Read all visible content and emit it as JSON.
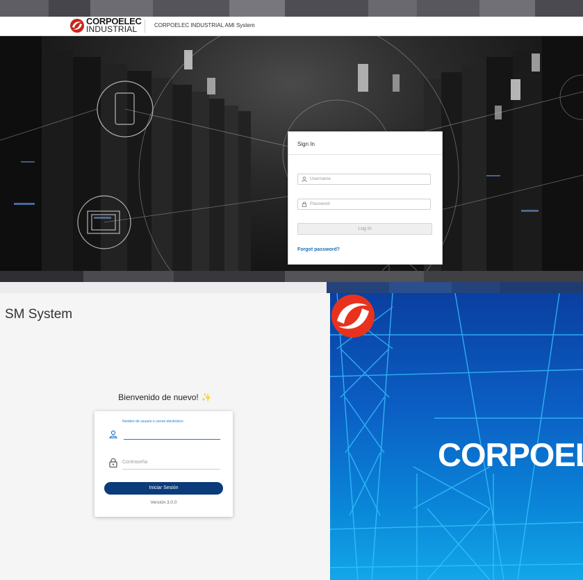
{
  "header": {
    "logo_line1": "CORPOELEC",
    "logo_line2": "INDUSTRIAL",
    "app_title": "CORPOELEC INDUSTRIAL AMI System"
  },
  "signin": {
    "title": "Sign In",
    "username_placeholder": "Username",
    "password_placeholder": "Password",
    "login_label": "Log In",
    "forgot_label": "Forgot password?"
  },
  "sm_panel": {
    "title": "SM System",
    "welcome": "Bienvenido de nuevo!",
    "welcome_icon": "sparkles-icon",
    "user_label": "Nombre de usuario o correo electrónico",
    "password_label": "Contraseña",
    "submit_label": "Iniciar Sesión",
    "version": "Versión 3.0.0"
  },
  "brand_panel": {
    "brand_text": "CORPOELE"
  },
  "colors": {
    "accent_blue": "#1e6fb0",
    "button_navy": "#0b3b7a",
    "brand_red": "#e8321e",
    "panel_blue": "#0b5ec4"
  }
}
